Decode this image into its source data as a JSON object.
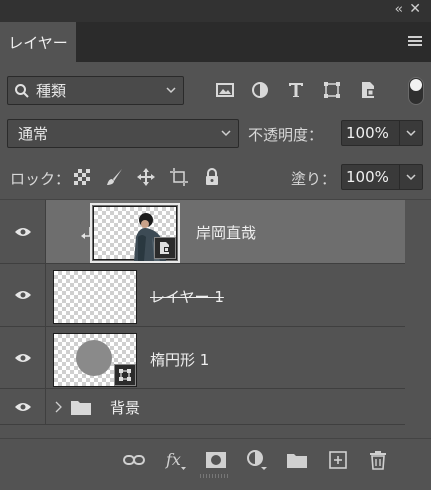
{
  "window": {
    "collapse_glyph": "‹‹",
    "close_glyph": "✕"
  },
  "tabs": [
    {
      "label": "レイヤー",
      "active": true
    }
  ],
  "filter": {
    "kind_label": "種類"
  },
  "blend": {
    "mode": "通常",
    "opacity_label": "不透明度：",
    "opacity_value": "100%"
  },
  "lock": {
    "label": "ロック：",
    "fill_label": "塗り：",
    "fill_value": "100%"
  },
  "layers": [
    {
      "name": "岸岡直哉",
      "type": "smart-object-clipped",
      "selected": true,
      "visible": true
    },
    {
      "name": "レイヤー 1",
      "type": "pixel",
      "strikethrough": true,
      "visible": true
    },
    {
      "name": "楕円形 1",
      "type": "shape",
      "visible": true
    },
    {
      "name": "背景",
      "type": "group",
      "visible": true
    }
  ],
  "footer_icons": [
    "link-layers-icon",
    "fx-icon",
    "add-mask-icon",
    "adjustment-layer-icon",
    "new-group-icon",
    "new-layer-icon",
    "delete-icon"
  ],
  "colors": {
    "panel": "#535353",
    "selected_row": "#6e6e6e",
    "tab_bar": "#2b2b2b"
  }
}
